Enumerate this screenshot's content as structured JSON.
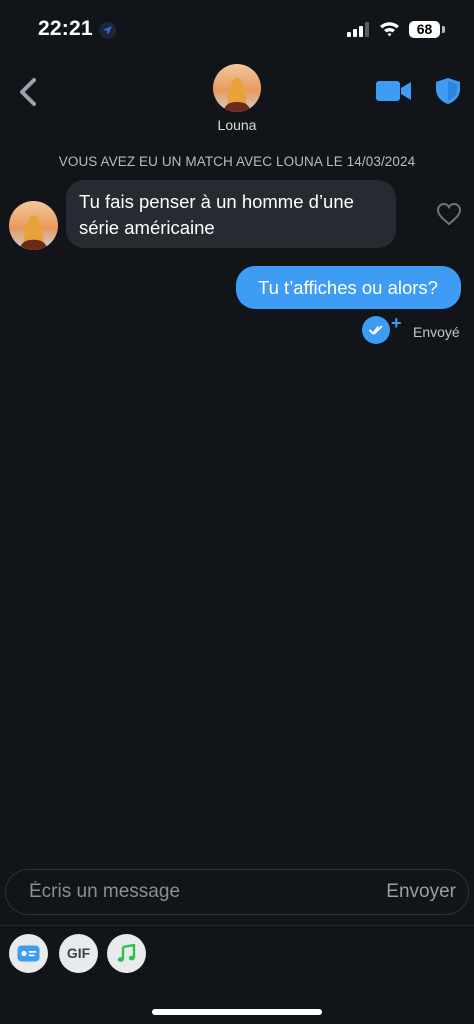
{
  "status_bar": {
    "time": "22:21",
    "battery": "68"
  },
  "header": {
    "contact_name": "Louna"
  },
  "match_banner": "VOUS AVEZ EU UN MATCH AVEC LOUNA LE 14/03/2024",
  "messages": [
    {
      "direction": "received",
      "lines": [
        "Tu fais penser à un homme d’une",
        "série américaine"
      ]
    },
    {
      "direction": "sent",
      "text": "Tu t’affiches ou alors?",
      "status": "Envoyé"
    }
  ],
  "compose": {
    "placeholder": "Écris un message",
    "send_label": "Envoyer"
  },
  "toolbar": {
    "gif_label": "GIF"
  },
  "colors": {
    "accent": "#3e9cf4",
    "background": "#111418",
    "received_bubble": "#262a31",
    "music": "#2fbf4f"
  },
  "icons": [
    "location-arrow-icon",
    "signal-icon",
    "wifi-icon",
    "battery-icon",
    "back-chevron-icon",
    "video-camera-icon",
    "shield-icon",
    "heart-outline-icon",
    "read-check-icon",
    "plus-icon",
    "id-card-icon",
    "music-note-icon"
  ]
}
